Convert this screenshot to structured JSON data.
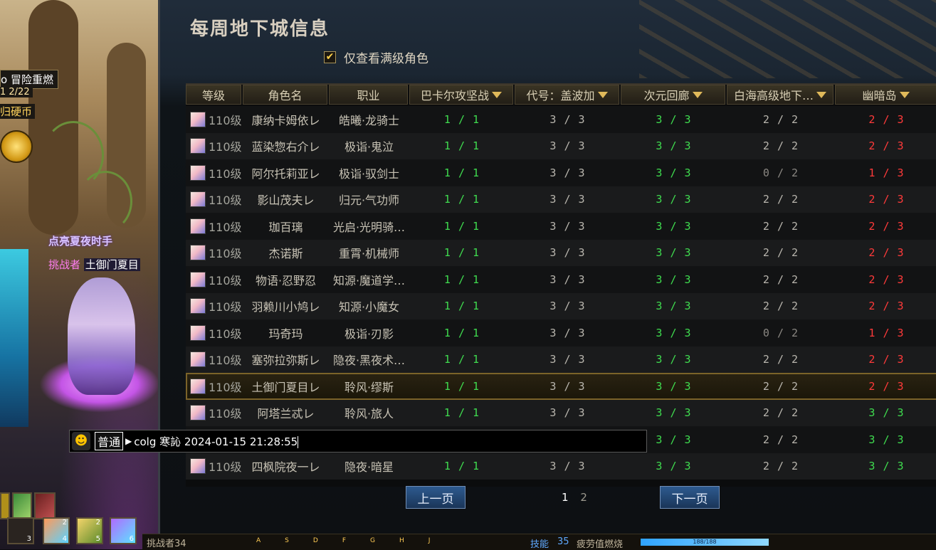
{
  "scene": {
    "event_title": "o 冒险重燃",
    "event_date": "1 2/22",
    "currency_label": "归硬币",
    "banner": "点亮夏夜时手",
    "player_prefix": "挑战者",
    "player_name": "土御门夏目",
    "skill_counts": [
      "3",
      "4",
      "5",
      "6"
    ],
    "skill_charges": [
      "2",
      "2"
    ]
  },
  "bottom_bar": {
    "player": "挑战者34",
    "keys": [
      "A",
      "S",
      "D",
      "F",
      "G",
      "H",
      "J"
    ],
    "skill_label": "技能",
    "skill_value": "35",
    "fatigue_label": "疲劳值燃烧",
    "fatigue_value": "188/188"
  },
  "panel": {
    "title": "每周地下城信息",
    "filter_checked": true,
    "filter_label": "仅查看满级角色",
    "checkbox_mark": "✔"
  },
  "table": {
    "headers": [
      "等级",
      "角色名",
      "职业",
      "巴卡尔攻坚战",
      "代号：盖波加",
      "次元回廊",
      "白海高级地下…",
      "幽暗岛"
    ],
    "rows": [
      {
        "level": "110级",
        "name": "康纳卡姆依レ",
        "job": "皓曦·龙骑士",
        "d1": "1 / 1",
        "d2": "3 / 3",
        "d3": "3 / 3",
        "d4": "2 / 2",
        "d5": "2 / 3"
      },
      {
        "level": "110级",
        "name": "蓝染惣右介レ",
        "job": "极诣·鬼泣",
        "d1": "1 / 1",
        "d2": "3 / 3",
        "d3": "3 / 3",
        "d4": "2 / 2",
        "d5": "2 / 3"
      },
      {
        "level": "110级",
        "name": "阿尔托莉亚レ",
        "job": "极诣·驭剑士",
        "d1": "1 / 1",
        "d2": "3 / 3",
        "d3": "3 / 3",
        "d4": "0 / 2",
        "d5": "1 / 3"
      },
      {
        "level": "110级",
        "name": "影山茂夫レ",
        "job": "归元·气功师",
        "d1": "1 / 1",
        "d2": "3 / 3",
        "d3": "3 / 3",
        "d4": "2 / 2",
        "d5": "2 / 3"
      },
      {
        "level": "110级",
        "name": "珈百璃",
        "job": "光启·光明骑…",
        "d1": "1 / 1",
        "d2": "3 / 3",
        "d3": "3 / 3",
        "d4": "2 / 2",
        "d5": "2 / 3"
      },
      {
        "level": "110级",
        "name": "杰诺斯",
        "job": "重霄·机械师",
        "d1": "1 / 1",
        "d2": "3 / 3",
        "d3": "3 / 3",
        "d4": "2 / 2",
        "d5": "2 / 3"
      },
      {
        "level": "110级",
        "name": "物语·忍野忍",
        "job": "知源·魔道学…",
        "d1": "1 / 1",
        "d2": "3 / 3",
        "d3": "3 / 3",
        "d4": "2 / 2",
        "d5": "2 / 3"
      },
      {
        "level": "110级",
        "name": "羽赖川小鸠レ",
        "job": "知源·小魔女",
        "d1": "1 / 1",
        "d2": "3 / 3",
        "d3": "3 / 3",
        "d4": "2 / 2",
        "d5": "2 / 3"
      },
      {
        "level": "110级",
        "name": "玛奇玛",
        "job": "极诣·刃影",
        "d1": "1 / 1",
        "d2": "3 / 3",
        "d3": "3 / 3",
        "d4": "0 / 2",
        "d5": "1 / 3"
      },
      {
        "level": "110级",
        "name": "塞弥拉弥斯レ",
        "job": "隐夜·黑夜术…",
        "d1": "1 / 1",
        "d2": "3 / 3",
        "d3": "3 / 3",
        "d4": "2 / 2",
        "d5": "2 / 3"
      },
      {
        "level": "110级",
        "name": "土御门夏目レ",
        "job": "聆风·缪斯",
        "d1": "1 / 1",
        "d2": "3 / 3",
        "d3": "3 / 3",
        "d4": "2 / 2",
        "d5": "2 / 3"
      },
      {
        "level": "110级",
        "name": "阿塔兰忒レ",
        "job": "聆风·旅人",
        "d1": "1 / 1",
        "d2": "3 / 3",
        "d3": "3 / 3",
        "d4": "2 / 2",
        "d5": "3 / 3"
      },
      {
        "level": "",
        "name": "",
        "job": "",
        "d1": "",
        "d2": "",
        "d3": "3 / 3",
        "d4": "2 / 2",
        "d5": "3 / 3"
      },
      {
        "level": "110级",
        "name": "四枫院夜一レ",
        "job": "隐夜·暗星",
        "d1": "1 / 1",
        "d2": "3 / 3",
        "d3": "3 / 3",
        "d4": "2 / 2",
        "d5": "3 / 3"
      }
    ],
    "selected_row": 10
  },
  "pagination": {
    "prev_label": "上一页",
    "next_label": "下一页",
    "pages": [
      "1",
      "2"
    ],
    "current_page": "1"
  },
  "chat": {
    "channel": "普通",
    "arrow": "▶",
    "input_text": "colg 寒訫 2024-01-15 21:28:55",
    "icon": "smiley-icon"
  },
  "colors": {
    "complete": "#3fdc4f",
    "partial": "#ff3a3a",
    "neutral": "#b9b6ae",
    "zero": "#8a8782",
    "accent_button": "#2d5a8f"
  }
}
